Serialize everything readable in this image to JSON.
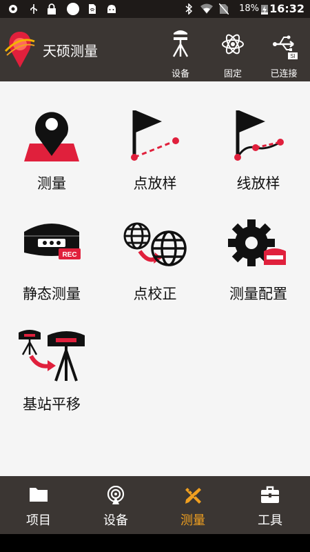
{
  "status_bar": {
    "battery_percent": "18%",
    "time": "16:32"
  },
  "app_bar": {
    "title": "天硕测量",
    "actions": [
      {
        "label": "设备",
        "icon": "gnss-receiver-icon"
      },
      {
        "label": "固定",
        "icon": "atom-fixed-icon"
      },
      {
        "label": "已连接",
        "icon": "usb-icon",
        "badge": "SI"
      }
    ]
  },
  "tiles": [
    {
      "label": "测量",
      "icon": "map-pin-icon"
    },
    {
      "label": "点放样",
      "icon": "flag-point-stakeout-icon"
    },
    {
      "label": "线放样",
      "icon": "flag-line-stakeout-icon"
    },
    {
      "label": "静态测量",
      "icon": "receiver-rec-icon",
      "icon_text": "REC"
    },
    {
      "label": "点校正",
      "icon": "globe-transform-icon"
    },
    {
      "label": "测量配置",
      "icon": "gear-config-icon"
    },
    {
      "label": "基站平移",
      "icon": "base-shift-icon"
    }
  ],
  "bottom_nav": {
    "active_index": 2,
    "items": [
      {
        "label": "项目",
        "icon": "folder-icon"
      },
      {
        "label": "设备",
        "icon": "antenna-icon"
      },
      {
        "label": "测量",
        "icon": "ruler-pencil-icon"
      },
      {
        "label": "工具",
        "icon": "toolbox-icon"
      }
    ]
  },
  "colors": {
    "bar_background": "#3b3633",
    "accent_red": "#e0203c",
    "active_nav": "#f0a020"
  }
}
